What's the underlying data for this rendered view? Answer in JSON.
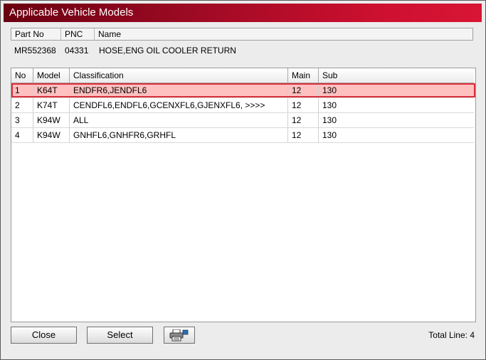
{
  "window": {
    "title": "Applicable Vehicle Models"
  },
  "part": {
    "headers": {
      "part_no": "Part No",
      "pnc": "PNC",
      "name": "Name"
    },
    "values": {
      "part_no": "MR552368",
      "pnc": "04331",
      "name": "HOSE,ENG OIL COOLER RETURN"
    }
  },
  "grid": {
    "headers": {
      "no": "No",
      "model": "Model",
      "classification": "Classification",
      "main": "Main",
      "sub": "Sub"
    },
    "rows": [
      {
        "no": "1",
        "model": "K64T",
        "classification": "ENDFR6,JENDFL6",
        "main": "12",
        "sub": "130"
      },
      {
        "no": "2",
        "model": "K74T",
        "classification": "CENDFL6,ENDFL6,GCENXFL6,GJENXFL6,  >>>>",
        "main": "12",
        "sub": "130"
      },
      {
        "no": "3",
        "model": "K94W",
        "classification": "ALL",
        "main": "12",
        "sub": "130"
      },
      {
        "no": "4",
        "model": "K94W",
        "classification": "GNHFL6,GNHFR6,GRHFL",
        "main": "12",
        "sub": "130"
      }
    ],
    "selected_row": 1
  },
  "buttons": {
    "close": "Close",
    "select": "Select",
    "print_icon": "printer-icon"
  },
  "footer": {
    "total_line": "Total Line: 4"
  },
  "colors": {
    "title_gradient_start": "#6a0010",
    "title_gradient_end": "#d81535",
    "selection_fill": "#ffc0c0",
    "selection_border": "#d9303c"
  }
}
